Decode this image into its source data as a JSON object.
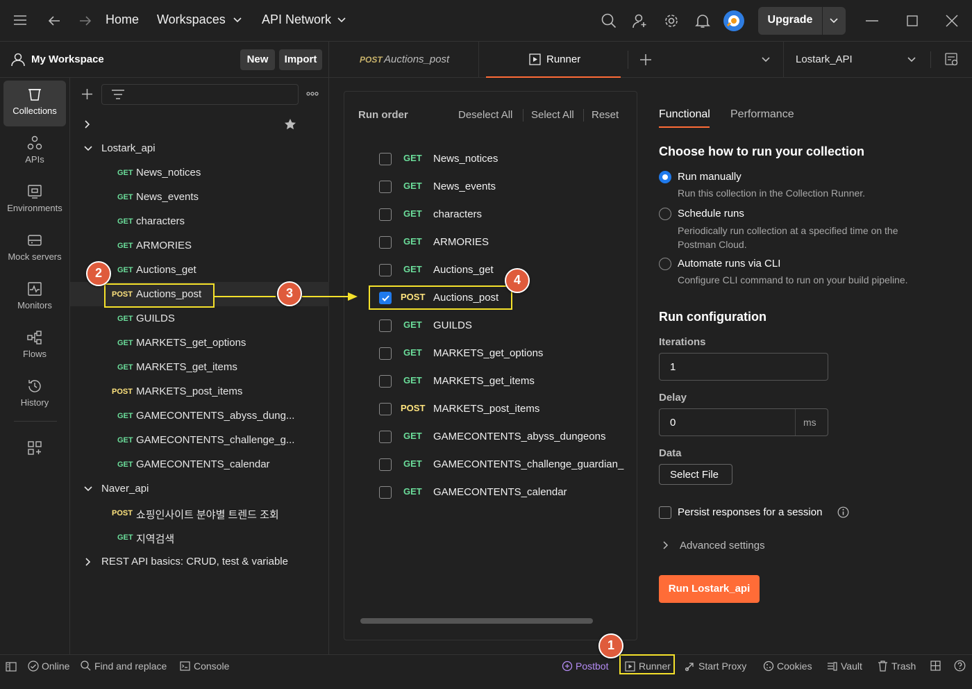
{
  "topbar": {
    "home": "Home",
    "workspaces": "Workspaces",
    "api_network": "API Network",
    "upgrade": "Upgrade"
  },
  "workspace": {
    "name": "My Workspace",
    "new_label": "New",
    "import_label": "Import"
  },
  "tabs": {
    "request_method": "POST",
    "request_name": "Auctions_post",
    "runner": "Runner",
    "environment": "Lostark_API"
  },
  "rail": [
    {
      "label": "Collections",
      "icon": "collections-icon",
      "active": true
    },
    {
      "label": "APIs",
      "icon": "apis-icon"
    },
    {
      "label": "Environments",
      "icon": "environments-icon"
    },
    {
      "label": "Mock servers",
      "icon": "mock-servers-icon"
    },
    {
      "label": "Monitors",
      "icon": "monitors-icon"
    },
    {
      "label": "Flows",
      "icon": "flows-icon"
    },
    {
      "label": "History",
      "icon": "history-icon"
    }
  ],
  "tree": {
    "lostark": {
      "name": "Lostark_api",
      "items": [
        {
          "method": "GET",
          "name": "News_notices"
        },
        {
          "method": "GET",
          "name": "News_events"
        },
        {
          "method": "GET",
          "name": "characters"
        },
        {
          "method": "GET",
          "name": "ARMORIES"
        },
        {
          "method": "GET",
          "name": "Auctions_get"
        },
        {
          "method": "POST",
          "name": "Auctions_post"
        },
        {
          "method": "GET",
          "name": "GUILDS"
        },
        {
          "method": "GET",
          "name": "MARKETS_get_options"
        },
        {
          "method": "GET",
          "name": "MARKETS_get_items"
        },
        {
          "method": "POST",
          "name": "MARKETS_post_items"
        },
        {
          "method": "GET",
          "name": "GAMECONTENTS_abyss_dung..."
        },
        {
          "method": "GET",
          "name": "GAMECONTENTS_challenge_g..."
        },
        {
          "method": "GET",
          "name": "GAMECONTENTS_calendar"
        }
      ]
    },
    "naver": {
      "name": "Naver_api",
      "items": [
        {
          "method": "POST",
          "name": "쇼핑인사이트 분야별 트렌드 조회"
        },
        {
          "method": "GET",
          "name": "지역검색"
        }
      ]
    },
    "rest": {
      "name": "REST API basics: CRUD, test & variable"
    }
  },
  "runner": {
    "run_order": "Run order",
    "deselect_all": "Deselect All",
    "select_all": "Select All",
    "reset": "Reset",
    "rows": [
      {
        "method": "GET",
        "name": "News_notices",
        "checked": false
      },
      {
        "method": "GET",
        "name": "News_events",
        "checked": false
      },
      {
        "method": "GET",
        "name": "characters",
        "checked": false
      },
      {
        "method": "GET",
        "name": "ARMORIES",
        "checked": false
      },
      {
        "method": "GET",
        "name": "Auctions_get",
        "checked": false
      },
      {
        "method": "POST",
        "name": "Auctions_post",
        "checked": true
      },
      {
        "method": "GET",
        "name": "GUILDS",
        "checked": false
      },
      {
        "method": "GET",
        "name": "MARKETS_get_options",
        "checked": false
      },
      {
        "method": "GET",
        "name": "MARKETS_get_items",
        "checked": false
      },
      {
        "method": "POST",
        "name": "MARKETS_post_items",
        "checked": false
      },
      {
        "method": "GET",
        "name": "GAMECONTENTS_abyss_dungeons",
        "checked": false
      },
      {
        "method": "GET",
        "name": "GAMECONTENTS_challenge_guardian_",
        "checked": false
      },
      {
        "method": "GET",
        "name": "GAMECONTENTS_calendar",
        "checked": false
      }
    ]
  },
  "config": {
    "tab_functional": "Functional",
    "tab_performance": "Performance",
    "heading": "Choose how to run your collection",
    "options": [
      {
        "label": "Run manually",
        "desc": "Run this collection in the Collection Runner.",
        "selected": true
      },
      {
        "label": "Schedule runs",
        "desc": "Periodically run collection at a specified time on the Postman Cloud.",
        "selected": false
      },
      {
        "label": "Automate runs via CLI",
        "desc": "Configure CLI command to run on your build pipeline.",
        "selected": false
      }
    ],
    "run_config": "Run configuration",
    "iterations_label": "Iterations",
    "iterations_value": "1",
    "delay_label": "Delay",
    "delay_value": "0",
    "delay_unit": "ms",
    "data_label": "Data",
    "select_file": "Select File",
    "persist": "Persist responses for a session",
    "advanced": "Advanced settings",
    "run_button": "Run Lostark_api"
  },
  "statusbar": {
    "online": "Online",
    "find_replace": "Find and replace",
    "console": "Console",
    "postbot": "Postbot",
    "runner": "Runner",
    "start_proxy": "Start Proxy",
    "cookies": "Cookies",
    "vault": "Vault",
    "trash": "Trash"
  },
  "annotations": [
    "1",
    "2",
    "3",
    "4"
  ],
  "colors": {
    "get": "#6bdd9a",
    "post": "#ffe47e",
    "accent": "#ff6c37",
    "checkbox": "#1f7aec",
    "highlight": "#f5e12b",
    "badge": "#df5b3c"
  }
}
